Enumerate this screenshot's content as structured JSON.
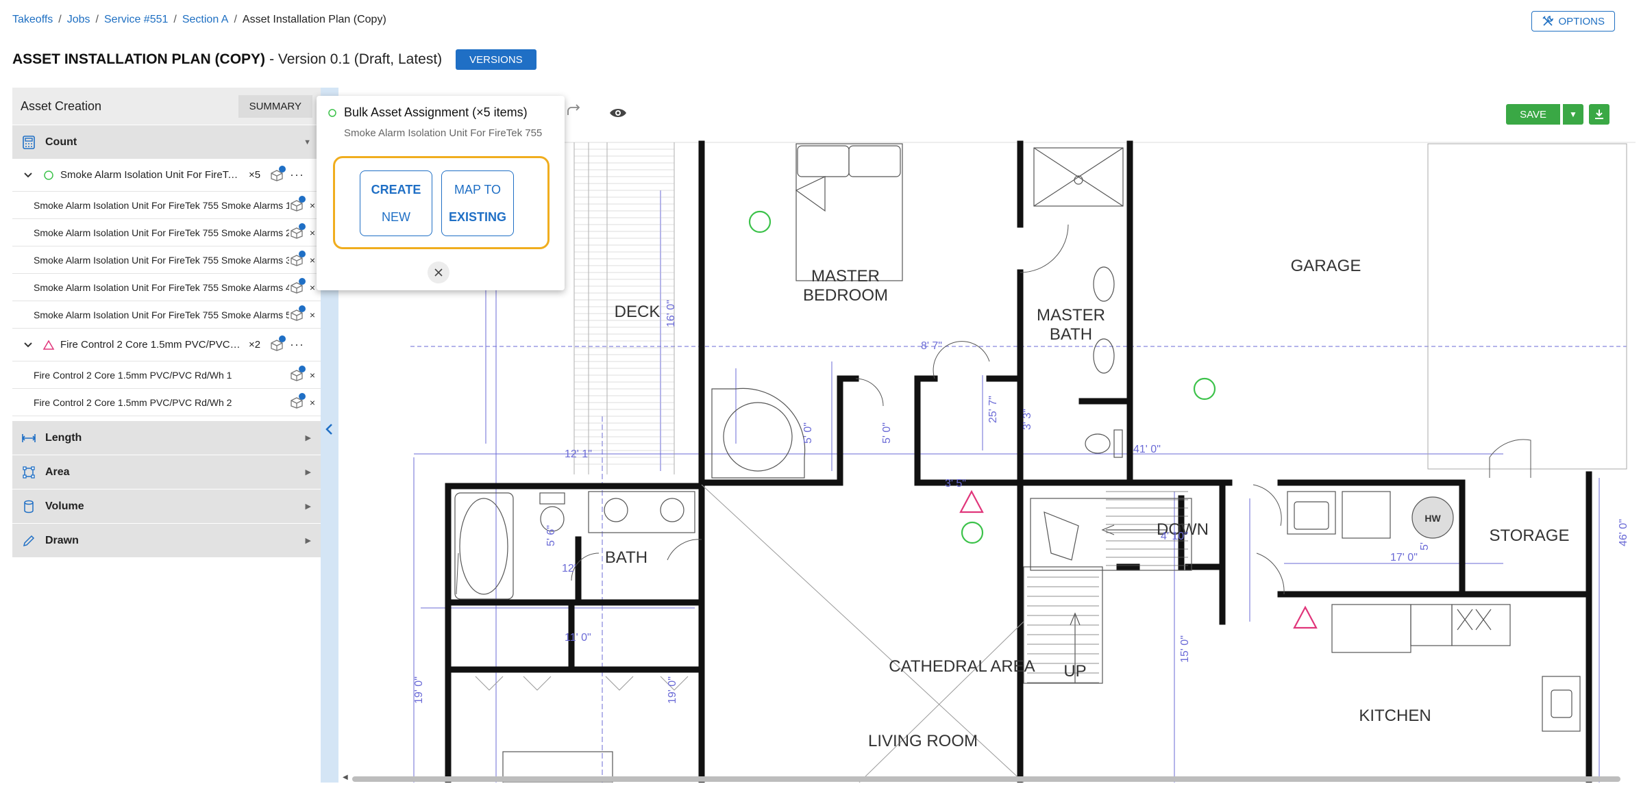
{
  "breadcrumb": {
    "items": [
      "Takeoffs",
      "Jobs",
      "Service #551",
      "Section A"
    ],
    "current": "Asset Installation Plan (Copy)"
  },
  "header": {
    "options_label": "OPTIONS",
    "title": "ASSET INSTALLATION PLAN (COPY)",
    "version": "- Version 0.1 (Draft, Latest)",
    "versions_label": "VERSIONS"
  },
  "panel": {
    "title": "Asset Creation",
    "summary_label": "SUMMARY",
    "categories": {
      "count": "Count",
      "length": "Length",
      "area": "Area",
      "volume": "Volume",
      "drawn": "Drawn"
    },
    "groups": [
      {
        "label": "Smoke Alarm Isolation Unit For FireTek 755 Smoke Alarms",
        "count": "×5",
        "marker_color": "#3cc24a",
        "items": [
          "Smoke Alarm Isolation Unit For FireTek 755 Smoke Alarms 1",
          "Smoke Alarm Isolation Unit For FireTek 755 Smoke Alarms 2",
          "Smoke Alarm Isolation Unit For FireTek 755 Smoke Alarms 3",
          "Smoke Alarm Isolation Unit For FireTek 755 Smoke Alarms 4",
          "Smoke Alarm Isolation Unit For FireTek 755 Smoke Alarms 5"
        ]
      },
      {
        "label": "Fire Control 2 Core 1.5mm PVC/PVC Rd/Wh",
        "count": "×2",
        "marker_color": "#e0357a",
        "items": [
          "Fire Control 2 Core 1.5mm PVC/PVC Rd/Wh 1",
          "Fire Control 2 Core 1.5mm PVC/PVC Rd/Wh 2"
        ]
      }
    ]
  },
  "toolbar": {
    "save_label": "SAVE"
  },
  "popup": {
    "title": "Bulk Asset Assignment (×5 items)",
    "subtitle": "Smoke Alarm Isolation Unit For FireTek 755",
    "create_line1": "CREATE",
    "create_line2": "NEW",
    "map_line1": "MAP TO",
    "map_line2": "EXISTING"
  },
  "floorplan": {
    "rooms": {
      "master_bedroom_1": "MASTER",
      "master_bedroom_2": "BEDROOM",
      "master_bath_1": "MASTER",
      "master_bath_2": "BATH",
      "garage": "GARAGE",
      "deck": "DECK",
      "bath": "BATH",
      "down": "DOWN",
      "storage": "STORAGE",
      "hw": "HW",
      "cathedral": "CATHEDRAL AREA",
      "up": "UP",
      "kitchen": "KITCHEN",
      "living": "LIVING ROOM"
    },
    "dims": {
      "d1": "8' 7\"",
      "d2": "16' 0\"",
      "d3": "12' 1\"",
      "d4": "5' 0\"",
      "d5": "5' 0\"",
      "d6": "25' 7\"",
      "d7": "3' 3\"",
      "d8": "3' 5\"",
      "d9": "41' 0\"",
      "d10": "17' 0\"",
      "d11": "12'",
      "d12": "5' 6\"",
      "d13": "15' 0\"",
      "d14": "19' 0\"",
      "d15": "46' 0\"",
      "d16": "19' 0\"",
      "d17": "11' 0\"",
      "d18": "4' 10\"",
      "d19": "5'"
    },
    "colors": {
      "count_marker": "#3cc24a",
      "fire_marker": "#e0357a",
      "dim_line": "#6a6ad6"
    }
  }
}
